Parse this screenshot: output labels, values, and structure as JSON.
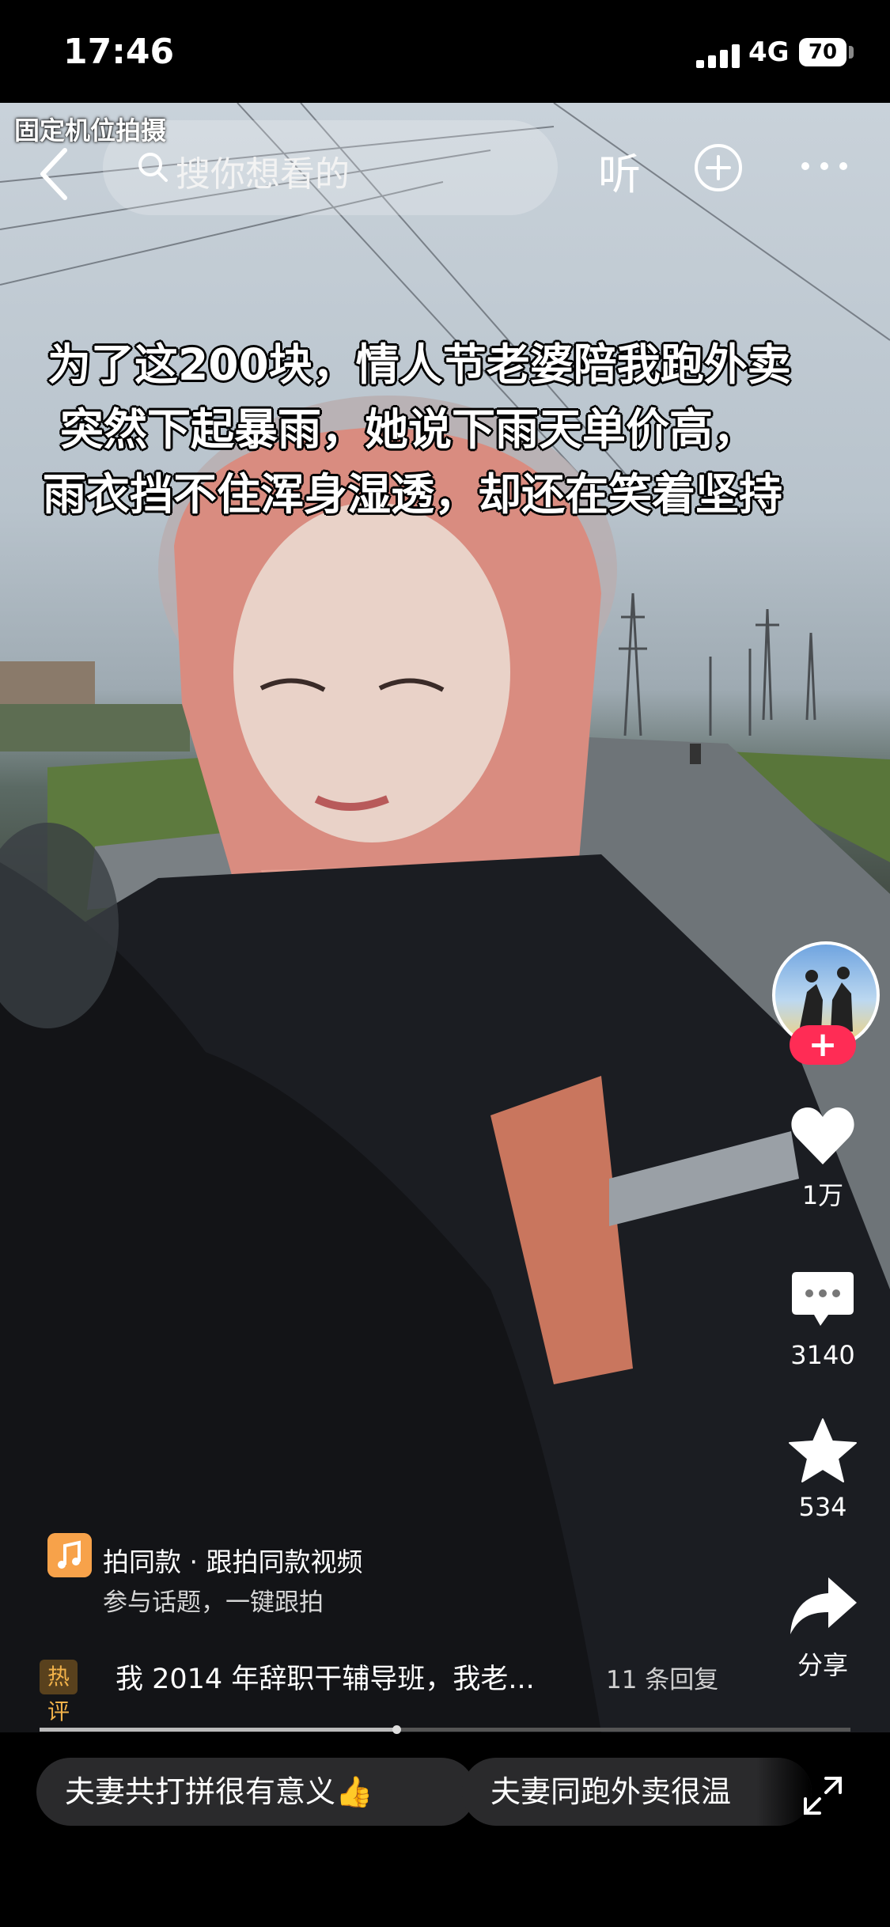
{
  "status_bar": {
    "time": "17:46",
    "network": "4G",
    "battery": "70"
  },
  "overlay_tag": "固定机位拍摄",
  "top_bar": {
    "search_placeholder": "搜你想看的",
    "listen_label": "听"
  },
  "caption": {
    "lines": [
      "为了这200块，情人节老婆陪我跑外卖",
      "突然下起暴雨，她说下雨天单价高，",
      "雨衣挡不住浑身湿透，却还在笑着坚持"
    ]
  },
  "actions": {
    "follow_label": "+",
    "likes": "1万",
    "comments": "3140",
    "favorites": "534",
    "share_label": "分享"
  },
  "music": {
    "title": "拍同款 · 跟拍同款视频",
    "subtitle": "参与话题，一键跟拍"
  },
  "hot_comment": {
    "badge": "热评",
    "text": "我 2014 年辞职干辅导班，我老...",
    "replies": "11 条回复"
  },
  "progress": {
    "fraction": 0.44
  },
  "chips": [
    "夫妻共打拼很有意义👍",
    "夫妻同跑外卖很温"
  ],
  "icons": [
    "back-icon",
    "search-icon",
    "add-icon",
    "more-icon",
    "heart-icon",
    "comment-icon",
    "star-icon",
    "share-icon",
    "music-icon",
    "expand-icon"
  ],
  "colors": {
    "follow_red": "#ff2c55",
    "hot_badge": "#f2b24a",
    "music_icon": "#f7a24a"
  }
}
